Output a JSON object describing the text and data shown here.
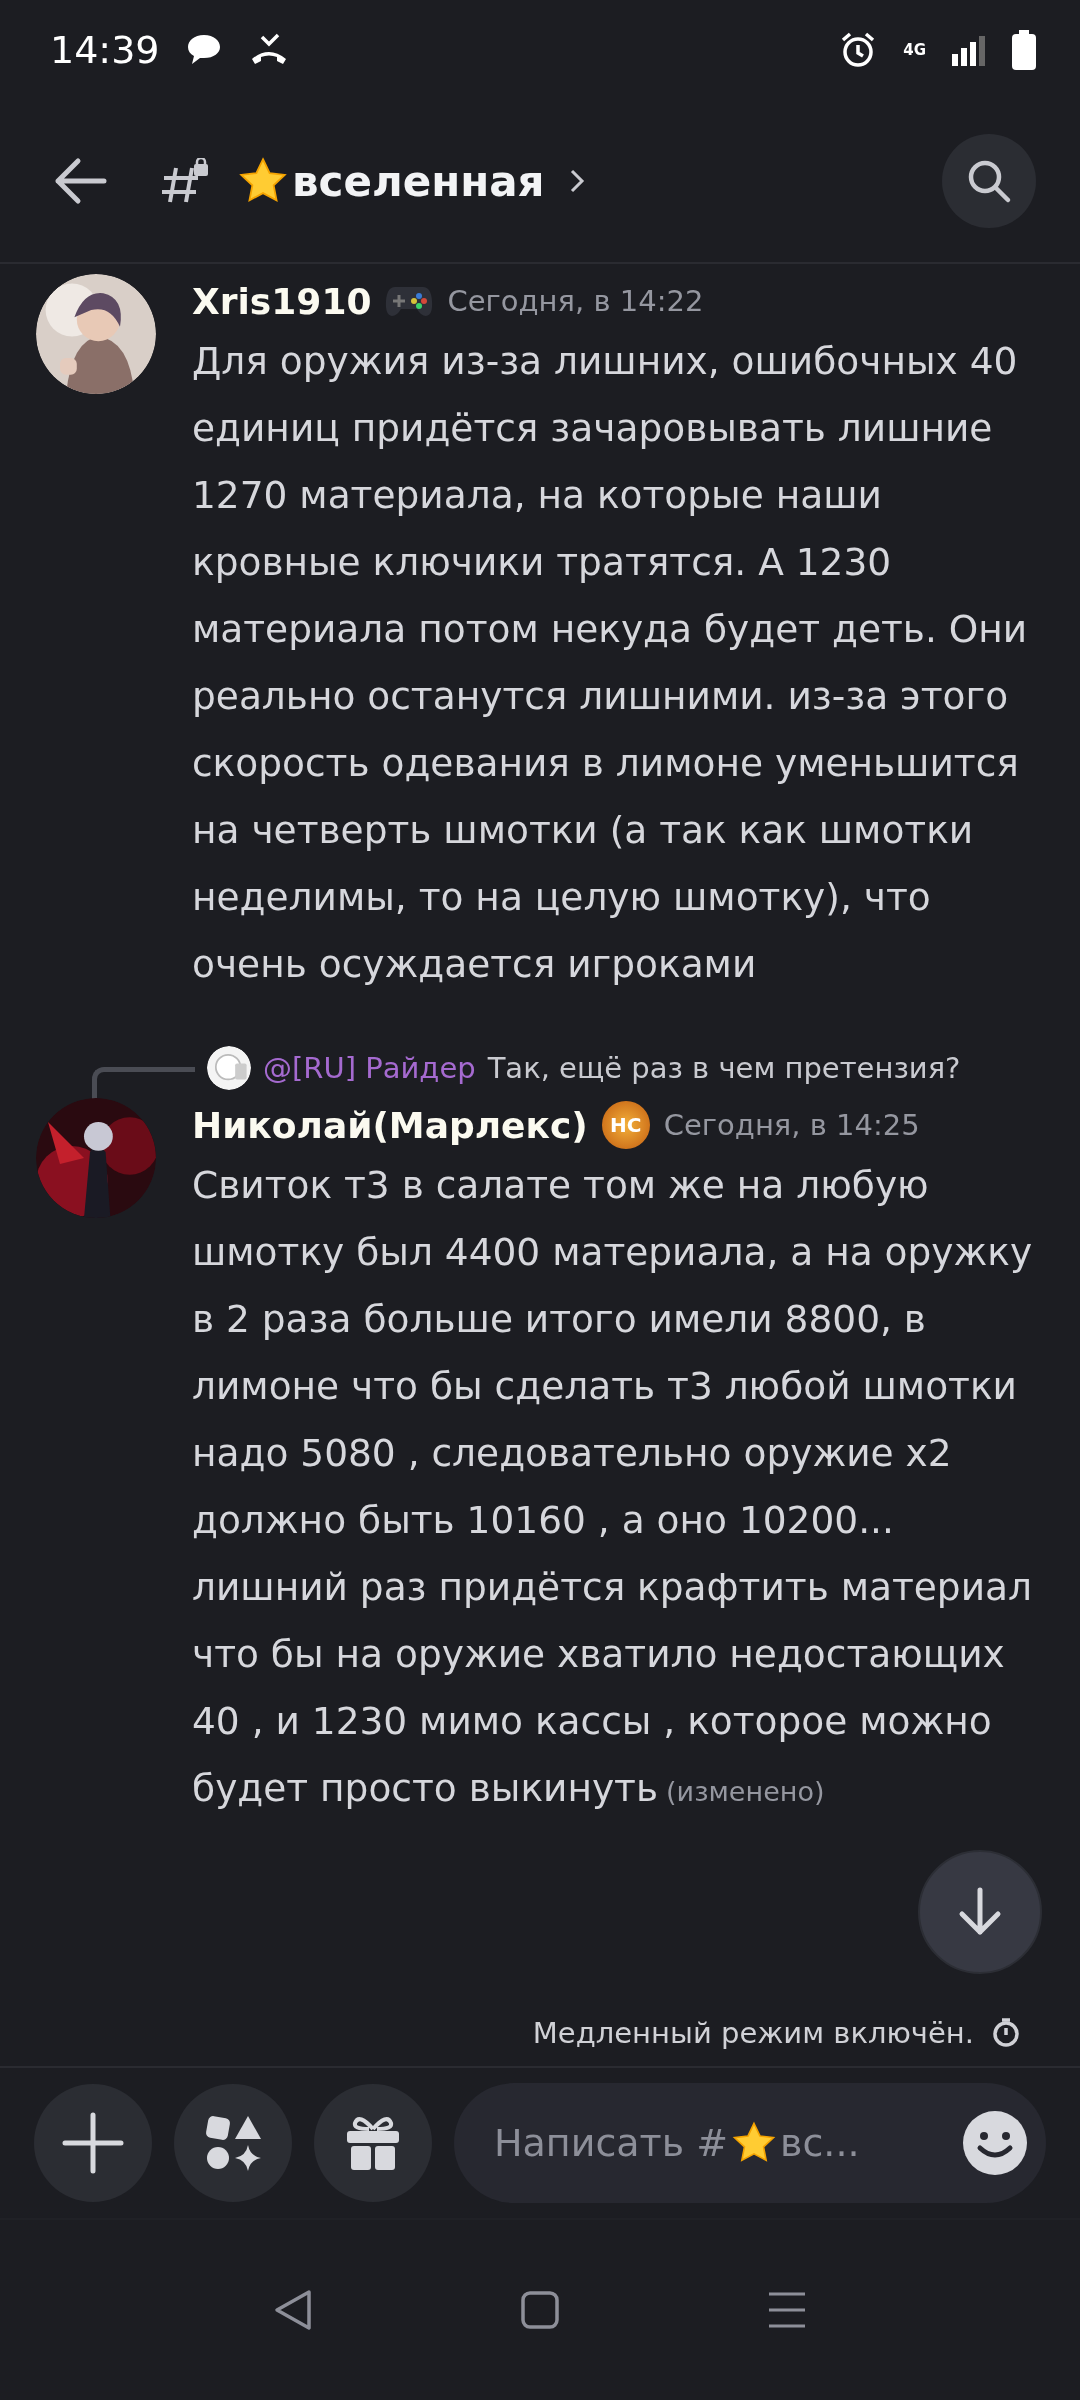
{
  "status_bar": {
    "time": "14:39",
    "network": "4G"
  },
  "header": {
    "channel": "вселенная"
  },
  "messages": [
    {
      "author": "Xris1910",
      "time": "Сегодня, в 14:22",
      "text": "Для оружия из-за лишних, ошибочных 40 единиц придётся зачаровывать лишние 1270 материала, на которые наши кровные ключики тратятся. А 1230 материала потом некуда будет деть. Они реально останутся лишними. из-за этого скорость одевания в лимоне уменьшится на четверть шмотки (а так как шмотки неделимы, то на целую шмотку), что очень осуждается игроками"
    },
    {
      "author": "Николай(Марлекс)",
      "author_badge": "HC",
      "time": "Сегодня, в 14:25",
      "reply": {
        "author": "@[RU] Райдер",
        "text": "Так, ещё раз в чем претензия?"
      },
      "text": "Свиток т3 в салате том же на любую шмотку был 4400 материала,  а на оружку в 2 раза больше итого имели 8800, в лимоне что бы сделать т3 любой шмотки надо 5080 , следовательно оружие х2 должно быть 10160 , а оно 10200... лишний раз придётся крафтить материал что бы на оружие хватило недостающих 40 , и 1230 мимо кассы , которое можно будет просто выкинуть",
      "edited": "(изменено)"
    }
  ],
  "slow_mode": "Медленный режим включён.",
  "composer": {
    "placeholder_start": "Написать #",
    "placeholder_end": "вс..."
  }
}
